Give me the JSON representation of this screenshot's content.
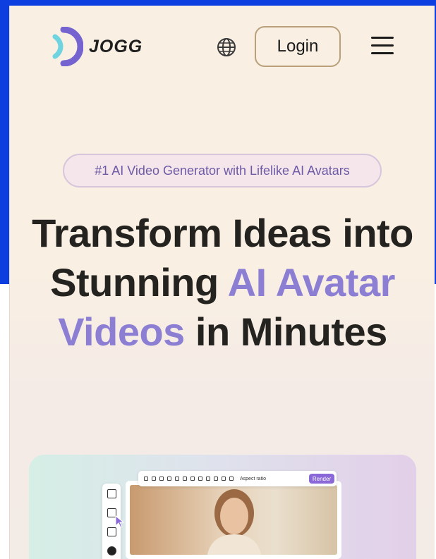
{
  "header": {
    "brand": "JOGG",
    "login_label": "Login",
    "icons": {
      "globe": "globe-icon",
      "menu": "hamburger-menu-icon"
    }
  },
  "hero": {
    "badge": "#1 AI Video Generator with Lifelike AI Avatars",
    "headline_part1": "Transform Ideas into Stunning ",
    "headline_accent": "AI Avatar Videos",
    "headline_part2": " in Minutes"
  },
  "preview": {
    "toolbar_label": "Aspect ratio",
    "render_label": "Render"
  },
  "colors": {
    "accent": "#8c7fd3",
    "background": "#f9efe3",
    "logo_light": "#6fd3e0",
    "logo_dark": "#7563d0",
    "render": "#8b68d8"
  }
}
